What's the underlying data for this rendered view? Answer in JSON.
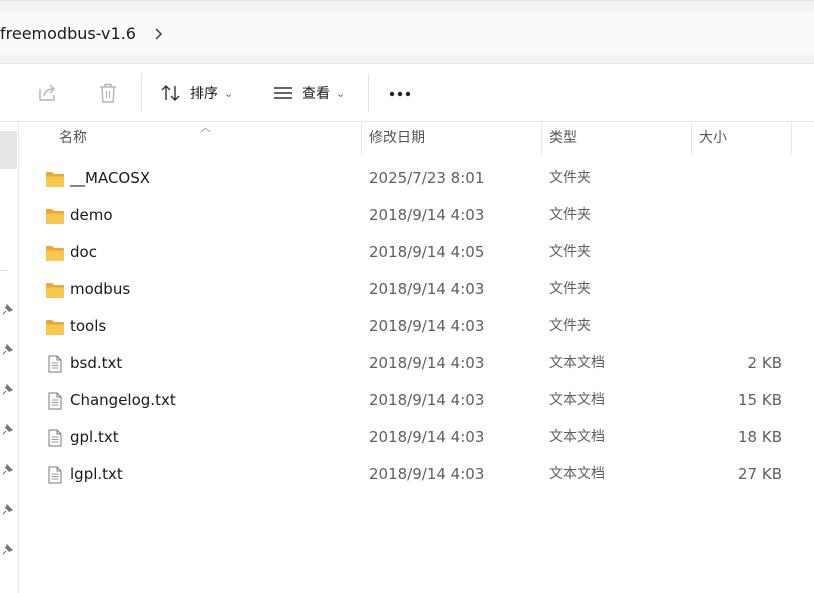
{
  "address": {
    "path_text": "freemodbus-v1.6",
    "chevron_icon": "chevron-right-icon"
  },
  "toolbar": {
    "share_icon": "share-icon",
    "delete_icon": "trash-icon",
    "sort_label": "排序",
    "view_label": "查看",
    "more_icon": "ellipsis-icon"
  },
  "columns": {
    "name": "名称",
    "date": "修改日期",
    "type": "类型",
    "size": "大小"
  },
  "files": [
    {
      "name": "__MACOSX",
      "date": "2025/7/23 8:01",
      "type": "文件夹",
      "size": "",
      "icon": "folder-icon"
    },
    {
      "name": "demo",
      "date": "2018/9/14 4:03",
      "type": "文件夹",
      "size": "",
      "icon": "folder-icon"
    },
    {
      "name": "doc",
      "date": "2018/9/14 4:05",
      "type": "文件夹",
      "size": "",
      "icon": "folder-icon"
    },
    {
      "name": "modbus",
      "date": "2018/9/14 4:03",
      "type": "文件夹",
      "size": "",
      "icon": "folder-icon"
    },
    {
      "name": "tools",
      "date": "2018/9/14 4:03",
      "type": "文件夹",
      "size": "",
      "icon": "folder-icon"
    },
    {
      "name": "bsd.txt",
      "date": "2018/9/14 4:03",
      "type": "文本文档",
      "size": "2 KB",
      "icon": "text-file-icon"
    },
    {
      "name": "Changelog.txt",
      "date": "2018/9/14 4:03",
      "type": "文本文档",
      "size": "15 KB",
      "icon": "text-file-icon"
    },
    {
      "name": "gpl.txt",
      "date": "2018/9/14 4:03",
      "type": "文本文档",
      "size": "18 KB",
      "icon": "text-file-icon"
    },
    {
      "name": "lgpl.txt",
      "date": "2018/9/14 4:03",
      "type": "文本文档",
      "size": "27 KB",
      "icon": "text-file-icon"
    }
  ],
  "colors": {
    "folder": "#f8c84a",
    "folder_dark": "#e8a93a",
    "accent": "#0067c0"
  }
}
